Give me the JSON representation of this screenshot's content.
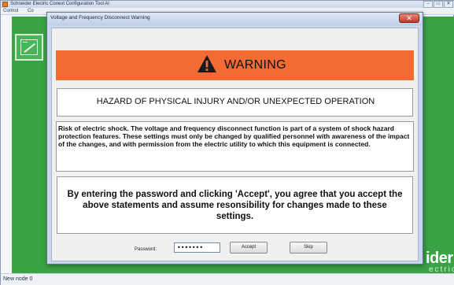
{
  "app": {
    "title": "Schneider Electric Conext Configuration Tool AI",
    "menu": [
      "Control",
      "Co"
    ],
    "window_controls": [
      "–",
      "▭",
      "✕"
    ],
    "brand_main": "ider",
    "brand_sub": "ectric",
    "status_text": "New node 0",
    "colors": {
      "panel_green": "#3aa346"
    }
  },
  "dialog": {
    "title": "Voltage and Frequency Disconnect Warning",
    "close_glyph": "✕",
    "warning_label": "WARNING",
    "hazard_heading": "HAZARD OF PHYSICAL INJURY AND/OR UNEXPECTED OPERATION",
    "risk_text": "Risk of electric shock. The voltage and frequency disconnect function is part of a system of shock hazard protection features. These settings must only be changed by qualified personnel with awareness of the impact of the changes, and with permission from the electric utility to which this equipment is connected.",
    "accept_text": "By entering the password and clicking 'Accept', you agree that you accept the above statements and assume resonsibility for changes made to these settings.",
    "password_label": "Password:",
    "password_value": "•••••••",
    "accept_label": "Accept",
    "skip_label": "Skip",
    "icons": {
      "warning": "warning-triangle-icon",
      "close": "close-icon",
      "tile": "inverter-icon"
    },
    "colors": {
      "banner": "#f36b32",
      "close": "#c0392b"
    }
  }
}
